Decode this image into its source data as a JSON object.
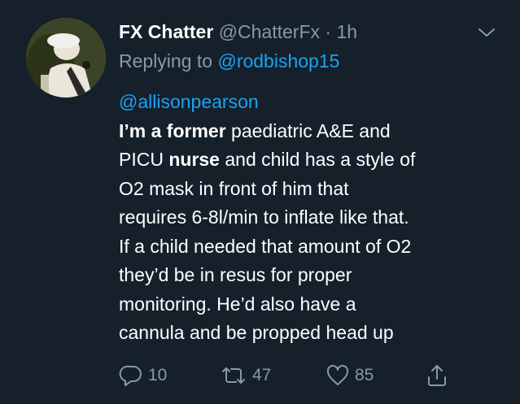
{
  "tweet": {
    "display_name": "FX Chatter",
    "handle": "@ChatterFx",
    "separator": "·",
    "time": "1h",
    "replying_prefix": "Replying to ",
    "replying_to": "@rodbishop15",
    "mention": "@allisonpearson",
    "lines": [
      {
        "segments": [
          {
            "text": "I’m a former",
            "bold": true
          },
          {
            "text": " paediatric A&E and",
            "bold": false
          }
        ]
      },
      {
        "segments": [
          {
            "text": "PICU ",
            "bold": false
          },
          {
            "text": "nurse",
            "bold": true
          },
          {
            "text": " and child has a style of",
            "bold": false
          }
        ]
      },
      {
        "segments": [
          {
            "text": "O2 mask in front of him that",
            "bold": false
          }
        ]
      },
      {
        "segments": [
          {
            "text": "requires 6-8l/min to inflate like that.",
            "bold": false
          }
        ]
      },
      {
        "segments": [
          {
            "text": "If a child needed that amount of O2",
            "bold": false
          }
        ]
      },
      {
        "segments": [
          {
            "text": "they’d be in resus for proper",
            "bold": false
          }
        ]
      },
      {
        "segments": [
          {
            "text": "monitoring. He’d also have a",
            "bold": false
          }
        ]
      },
      {
        "segments": [
          {
            "text": "cannula and be propped head up",
            "bold": false
          }
        ]
      }
    ],
    "actions": {
      "reply_count": "10",
      "retweet_count": "47",
      "like_count": "85"
    }
  },
  "icons": {
    "chevron": "chevron-down-icon",
    "reply": "reply-icon",
    "retweet": "retweet-icon",
    "like": "heart-icon",
    "share": "share-icon"
  },
  "colors": {
    "background": "#15202b",
    "primary_text": "#ffffff",
    "secondary_text": "#8899a6",
    "accent": "#1da1f2"
  }
}
